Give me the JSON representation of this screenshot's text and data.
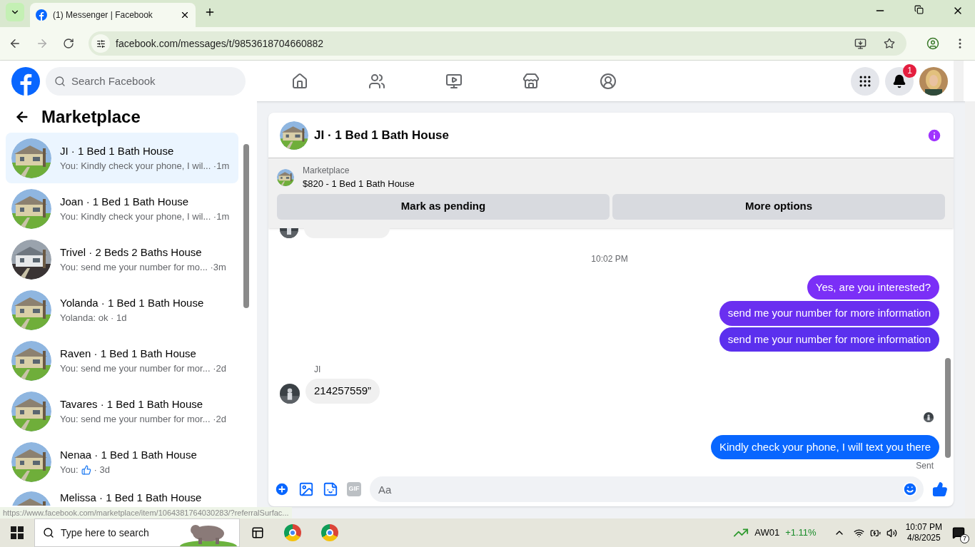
{
  "browser": {
    "tab_title": "(1) Messenger | Facebook",
    "url": "facebook.com/messages/t/9853618704660882"
  },
  "facebook_nav": {
    "search_placeholder": "Search Facebook",
    "notification_count": "1"
  },
  "sidebar": {
    "title": "Marketplace",
    "conversations": [
      {
        "name": "JI · 1 Bed 1 Bath House",
        "preview": "You: Kindly check your phone, I wil... ·1m",
        "selected": true,
        "kind": "text"
      },
      {
        "name": "Joan · 1 Bed 1 Bath House",
        "preview": "You: Kindly check your phone, I wil... ·1m",
        "selected": false,
        "kind": "text"
      },
      {
        "name": "Trivel · 2 Beds 2 Baths House",
        "preview": "You: send me your number for mo... ·3m",
        "selected": false,
        "kind": "text"
      },
      {
        "name": "Yolanda · 1 Bed 1 Bath House",
        "preview": "Yolanda: ok · 1d",
        "selected": false,
        "kind": "text"
      },
      {
        "name": "Raven · 1 Bed 1 Bath House",
        "preview": "You: send me your number for mor... ·2d",
        "selected": false,
        "kind": "text"
      },
      {
        "name": "Tavares · 1 Bed 1 Bath House",
        "preview": "You: send me your number for mor... ·2d",
        "selected": false,
        "kind": "text"
      },
      {
        "name": "Nenaa · 1 Bed 1 Bath House",
        "preview": "You:",
        "suffix": "· 3d",
        "selected": false,
        "kind": "like"
      },
      {
        "name": "Melissa · 1 Bed 1 Bath House",
        "selected": false,
        "kind": "cut"
      }
    ],
    "link_preview": "https://www.facebook.com/marketplace/item/1064381764030283/?referralSurfac..."
  },
  "chat": {
    "title": "JI · 1 Bed 1 Bath House",
    "listing_label": "Marketplace",
    "listing": "$820 - 1 Bed 1 Bath House",
    "buttons": [
      "Mark as pending",
      "More options"
    ],
    "messages": [
      {
        "kind": "cut"
      },
      {
        "kind": "time",
        "text": "10:02 PM"
      },
      {
        "kind": "outgoing",
        "text": "Yes, are you interested?",
        "color": "#7b2ff7"
      },
      {
        "kind": "outgoing",
        "text": "send me your number for more information",
        "color": "#6a2ff0"
      },
      {
        "kind": "outgoing",
        "text": "send me your number for more information",
        "color": "#5b30ee"
      },
      {
        "kind": "sender",
        "text": "JI"
      },
      {
        "kind": "incoming",
        "text": "214257559”"
      },
      {
        "kind": "seen"
      },
      {
        "kind": "outgoing",
        "text": "Kindly check your phone, I will text you there",
        "color": "#0866ff"
      },
      {
        "kind": "status",
        "text": "Sent"
      }
    ],
    "composer_placeholder": "Aa",
    "gif_label": "GIF"
  },
  "taskbar": {
    "search_placeholder": "Type here to search",
    "stock_name": "AW01",
    "stock_change": "+1.11%",
    "time": "10:07 PM",
    "date": "4/8/2025",
    "notifications": "7"
  }
}
